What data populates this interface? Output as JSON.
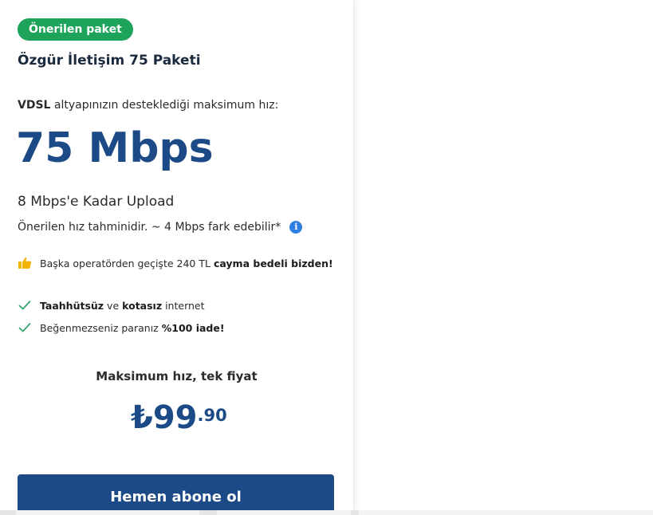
{
  "colors": {
    "badge_bg": "#1ea35b",
    "brand_blue": "#1c4a86",
    "info_blue": "#2f7fe0",
    "check_green": "#2ea36a",
    "thumb_yellow": "#f4b400",
    "button_bg": "#1c4a86"
  },
  "card": {
    "badge": "Önerilen paket",
    "title": "Özgür İletişim 75 Paketi",
    "speed_intro_bold": "VDSL",
    "speed_intro_rest": " altyapınızın desteklediği maksimum hız:",
    "speed_value": "75 Mbps",
    "upload": "8 Mbps'e Kadar Upload",
    "estimate": "Önerilen hız tahminidir. ~ 4 Mbps fark edebilir*",
    "info_icon": "info-icon",
    "features": {
      "cancellation": {
        "icon": "thumbs-up-icon",
        "text_before": "Başka operatörden geçişte 240 TL",
        "text_bold": "cayma bedeli bizden!"
      },
      "commitment": {
        "icon": "check-icon",
        "bold1": "Taahhütsüz",
        "mid": " ve ",
        "bold2": "kotasız",
        "after": " internet"
      },
      "refund": {
        "icon": "check-icon",
        "text_before": "Beğenmezseniz paranız",
        "text_bold": "%100 iade!"
      }
    },
    "price_caption": "Maksimum hız, tek fiyat",
    "price": {
      "currency": "₺",
      "amount": "99",
      "cents": ".90"
    },
    "cta_label": "Hemen abone ol"
  }
}
